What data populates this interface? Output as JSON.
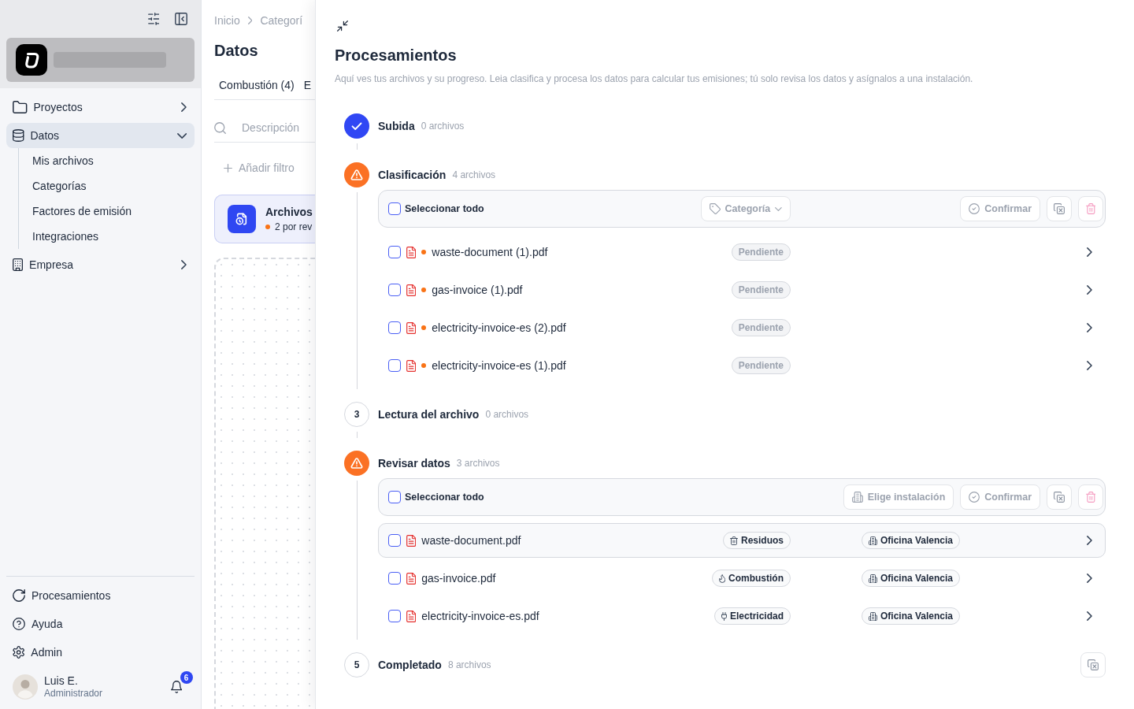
{
  "sidebar": {
    "nav": [
      {
        "label": "Proyectos",
        "selected": false,
        "expanded": false
      },
      {
        "label": "Datos",
        "selected": true,
        "expanded": true,
        "children": [
          {
            "label": "Mis archivos",
            "selected": false
          },
          {
            "label": "Categorías",
            "selected": false
          },
          {
            "label": "Factores de emisión",
            "selected": false
          },
          {
            "label": "Integraciones",
            "selected": false
          }
        ]
      },
      {
        "label": "Empresa",
        "selected": false,
        "expanded": false
      }
    ],
    "footer_nav": [
      {
        "label": "Procesamientos",
        "selected": false
      },
      {
        "label": "Ayuda",
        "selected": false
      },
      {
        "label": "Admin",
        "selected": false
      }
    ],
    "user": {
      "name": "Luis E.",
      "role": "Administrador",
      "notifications": "6"
    }
  },
  "page": {
    "breadcrumb": [
      "Inicio",
      "Categorí"
    ],
    "title": "Datos",
    "tabs": [
      "Combustión (4)",
      "E"
    ],
    "search": {
      "placeholder": "Descripción"
    },
    "add_filter": "Añadir filtro",
    "files_card": {
      "title": "Archivos",
      "status": "2 por rev"
    }
  },
  "panel": {
    "title": "Procesamientos",
    "description": "Aquí ves tus archivos y su progreso. Leia clasifica y procesa los datos para calcular tus emisiones; tú solo revisa los datos y asígnalos a una instalación.",
    "steps": [
      {
        "kind": "simple",
        "completed": true,
        "needs_review": false,
        "title": "Subida",
        "count": "0 archivos"
      },
      {
        "kind": "batch",
        "completed": false,
        "needs_review": true,
        "title": "Clasificación",
        "count": "4 archivos",
        "select_all": {
          "label": "Seleccionar todo",
          "checked": false
        },
        "actions": [
          {
            "kind": "category",
            "label": "Categoría",
            "disabled": true
          },
          {
            "kind": "confirm",
            "label": "Confirmar",
            "disabled": true
          }
        ],
        "files": [
          {
            "name": "waste-document (1).pdf",
            "checked": false,
            "highlighted": false,
            "badge": "Pendiente"
          },
          {
            "name": "gas-invoice (1).pdf",
            "checked": false,
            "highlighted": false,
            "badge": "Pendiente"
          },
          {
            "name": "electricity-invoice-es (2).pdf",
            "checked": false,
            "highlighted": false,
            "badge": "Pendiente"
          },
          {
            "name": "electricity-invoice-es (1).pdf",
            "checked": false,
            "highlighted": false,
            "badge": "Pendiente"
          }
        ]
      },
      {
        "kind": "simple",
        "completed": false,
        "needs_review": false,
        "number": "3",
        "title": "Lectura del archivo",
        "count": "0 archivos"
      },
      {
        "kind": "batch",
        "completed": false,
        "needs_review": true,
        "title": "Revisar datos",
        "count": "3 archivos",
        "select_all": {
          "label": "Seleccionar todo",
          "checked": false
        },
        "actions": [
          {
            "kind": "location",
            "label": "Elige instalación",
            "disabled": true
          },
          {
            "kind": "confirm",
            "label": "Confirmar",
            "disabled": true
          }
        ],
        "files": [
          {
            "name": "waste-document.pdf",
            "checked": false,
            "highlighted": true,
            "category": {
              "kind": "waste",
              "label": "Residuos"
            },
            "location": "Oficina Valencia"
          },
          {
            "name": "gas-invoice.pdf",
            "checked": false,
            "highlighted": false,
            "category": {
              "kind": "combustion",
              "label": "Combustión"
            },
            "location": "Oficina Valencia"
          },
          {
            "name": "electricity-invoice-es.pdf",
            "checked": false,
            "highlighted": false,
            "category": {
              "kind": "electricity",
              "label": "Electricidad"
            },
            "location": "Oficina Valencia"
          }
        ]
      },
      {
        "kind": "summary",
        "completed": false,
        "needs_review": false,
        "number": "5",
        "title": "Completado",
        "count": "8 archivos"
      }
    ]
  }
}
